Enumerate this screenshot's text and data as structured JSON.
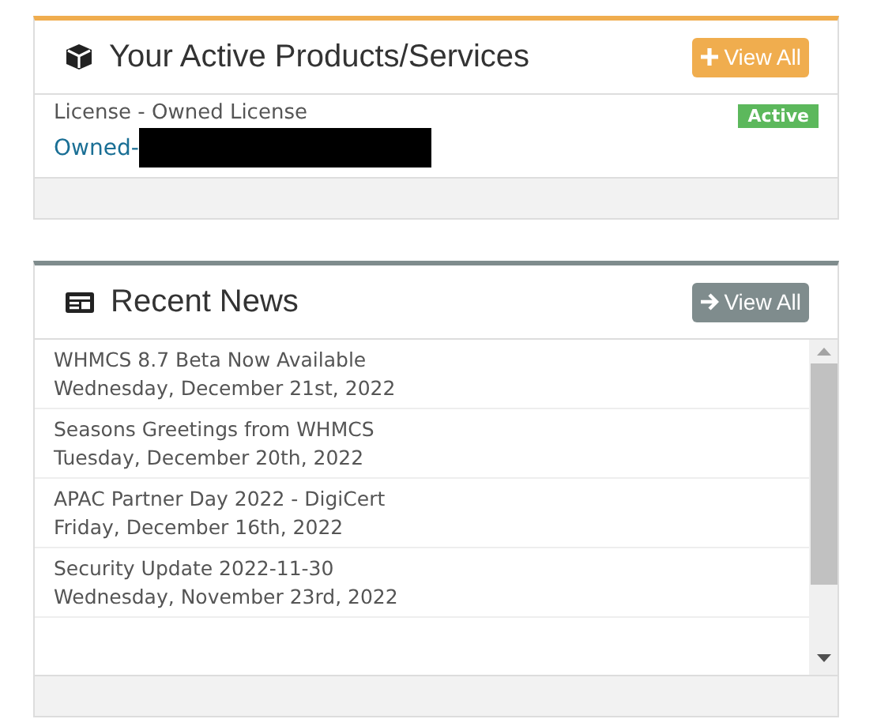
{
  "panels": [
    {
      "kind": "products",
      "title": "Your Active Products/Services",
      "button": {
        "label": "View All"
      },
      "items": [
        {
          "name": "License - Owned License",
          "domain": "Owned-",
          "redacted": true,
          "status": "Active"
        }
      ]
    },
    {
      "kind": "news",
      "title": "Recent News",
      "button": {
        "label": "View All"
      },
      "items": [
        {
          "title": "WHMCS 8.7 Beta Now Available",
          "date": "Wednesday, December 21st, 2022"
        },
        {
          "title": "Seasons Greetings from WHMCS",
          "date": "Tuesday, December 20th, 2022"
        },
        {
          "title": "APAC Partner Day 2022 - DigiCert",
          "date": "Friday, December 16th, 2022"
        },
        {
          "title": "Security Update 2022-11-30",
          "date": "Wednesday, November 23rd, 2022"
        }
      ]
    }
  ]
}
